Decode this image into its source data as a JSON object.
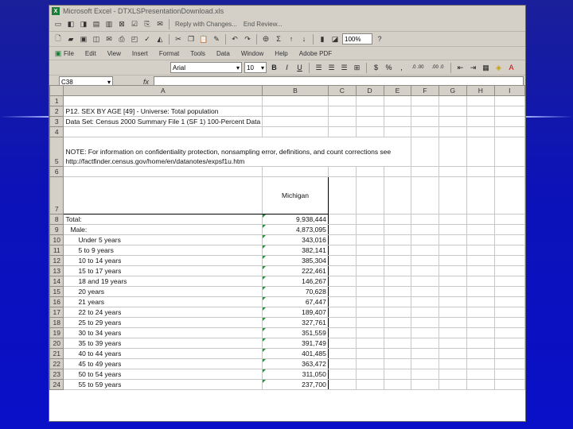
{
  "window": {
    "title": "Microsoft Excel - DTXLSPresentationDownload.xls"
  },
  "toolbar_review": {
    "reply_label": "Reply with Changes...",
    "end_review_label": "End Review...",
    "zoom": "100%"
  },
  "menu": [
    "File",
    "Edit",
    "View",
    "Insert",
    "Format",
    "Tools",
    "Data",
    "Window",
    "Help",
    "Adobe PDF"
  ],
  "format": {
    "font": "Arial",
    "size": "10",
    "bold": "B",
    "italic": "I",
    "underline": "U",
    "currency": "$",
    "percent": "%",
    "comma": ",",
    "inc_decimal": ".0 .00",
    "dec_decimal": ".00 .0"
  },
  "namebox": {
    "cell": "C38",
    "fx": "fx"
  },
  "columns": [
    "A",
    "B",
    "C",
    "D",
    "E",
    "F",
    "G",
    "H",
    "I"
  ],
  "rows": [
    {
      "n": "1",
      "a": "",
      "b": ""
    },
    {
      "n": "2",
      "a": "P12. SEX BY AGE [49] - Universe: Total population",
      "b": ""
    },
    {
      "n": "3",
      "a": "Data Set: Census 2000 Summary File 1 (SF 1) 100-Percent Data",
      "b": ""
    },
    {
      "n": "4",
      "a": "",
      "b": ""
    },
    {
      "n": "5",
      "a": "NOTE: For information on confidentiality protection, nonsampling error, definitions, and count corrections see http://factfinder.census.gov/home/en/datanotes/expsf1u.htm",
      "b": ""
    },
    {
      "n": "6",
      "a": "",
      "b": ""
    },
    {
      "n": "7",
      "a": "",
      "b": "Michigan"
    },
    {
      "n": "8",
      "a": "Total:",
      "b": "9,938,444"
    },
    {
      "n": "9",
      "a": "Male:",
      "b": "4,873,095"
    },
    {
      "n": "10",
      "a": "Under 5 years",
      "b": "343,016"
    },
    {
      "n": "11",
      "a": "5 to 9 years",
      "b": "382,141"
    },
    {
      "n": "12",
      "a": "10 to 14 years",
      "b": "385,304"
    },
    {
      "n": "13",
      "a": "15 to 17 years",
      "b": "222,461"
    },
    {
      "n": "14",
      "a": "18 and 19 years",
      "b": "146,267"
    },
    {
      "n": "15",
      "a": "20 years",
      "b": "70,628"
    },
    {
      "n": "16",
      "a": "21 years",
      "b": "67,447"
    },
    {
      "n": "17",
      "a": "22 to 24 years",
      "b": "189,407"
    },
    {
      "n": "18",
      "a": "25 to 29 years",
      "b": "327,761"
    },
    {
      "n": "19",
      "a": "30 to 34 years",
      "b": "351,559"
    },
    {
      "n": "20",
      "a": "35 to 39 years",
      "b": "391,749"
    },
    {
      "n": "21",
      "a": "40 to 44 years",
      "b": "401,485"
    },
    {
      "n": "22",
      "a": "45 to 49 years",
      "b": "363,472"
    },
    {
      "n": "23",
      "a": "50 to 54 years",
      "b": "311,050"
    },
    {
      "n": "24",
      "a": "55 to 59 years",
      "b": "237,700"
    }
  ]
}
